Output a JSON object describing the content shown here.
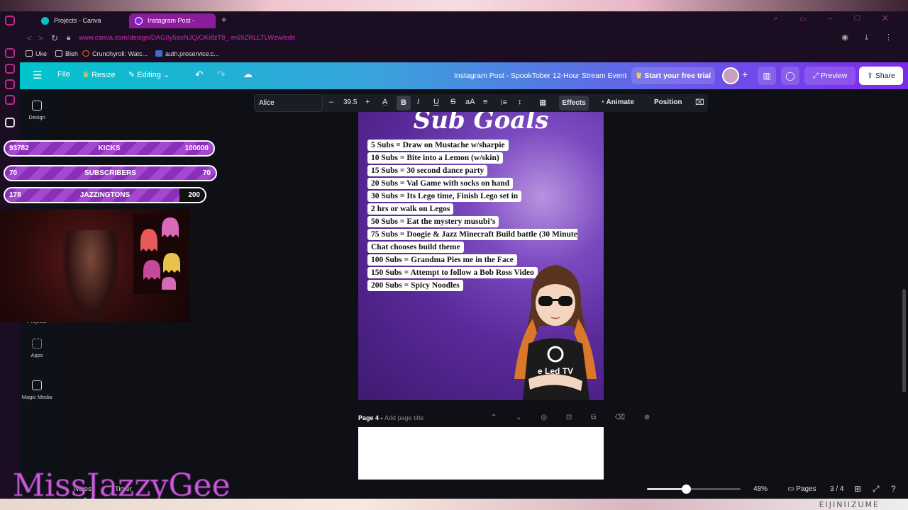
{
  "browser": {
    "tabs": [
      {
        "label": "Projects - Canva"
      },
      {
        "label": "Instagram Post - SpookTo"
      }
    ],
    "url": "www.canva.com/design/DAG0y5asNJQ/OKi8zT8_-m69ZRLLTLWzw/edit",
    "bookmarks": [
      {
        "label": "Uke"
      },
      {
        "label": "Bleh"
      },
      {
        "label": "Crunchyroll: Watc..."
      },
      {
        "label": "auth.proservice.c..."
      }
    ]
  },
  "header": {
    "file_label": "File",
    "resize_label": "Resize",
    "editing_label": "Editing",
    "title": "Instagram Post - SpookTober 12-Hour Stream Event",
    "trial_label": "Start your free trial",
    "preview_label": "Preview",
    "share_label": "Share"
  },
  "sidebar": {
    "items": [
      {
        "label": "Design"
      },
      {
        "label": "Projects"
      },
      {
        "label": "Apps"
      },
      {
        "label": "Magic Media"
      }
    ]
  },
  "toolbar": {
    "font": "Alice",
    "font_size": "39.5",
    "effects_label": "Effects",
    "animate_label": "Animate",
    "position_label": "Position"
  },
  "design": {
    "title": "Sub Goals",
    "goals": [
      "5 Subs = Draw on Mustache w/sharpie",
      "10 Subs = Bite into a Lemon (w/skin)",
      "15 Subs = 30 second dance party",
      "20 Subs = Val Game with socks on hand",
      "30 Subs = Its Lego time, Finish Lego set in",
      " 2 hrs or walk on Legos",
      "50 Subs = Eat the mystery musubi’s",
      "75 Subs = Doogie & Jazz Minecraft Build battle (30 Minute",
      "Chat chooses build theme",
      "100 Subs = Grandma Pies me in the Face",
      "150 Subs = Attempt to follow a Bob Ross Video",
      "200 Subs = Spicy Noodles"
    ],
    "shirt_text": "e Led TV"
  },
  "page4": {
    "label": "Page 4 -",
    "placeholder": "Add page title"
  },
  "overlays": {
    "goal_bars": [
      {
        "current": "93782",
        "label": "KICKS",
        "target": "100000"
      },
      {
        "current": "70",
        "label": "SUBSCRIBERS",
        "target": "70"
      },
      {
        "current": "178",
        "label": "JAZZINGTONS",
        "target": "200"
      }
    ],
    "streamer_name": "MissJazzyGee",
    "bottom_watermark": "EIJINIIZUME"
  },
  "footer": {
    "notes_label": "Notes",
    "timer_label": "Timer",
    "zoom": "48%",
    "zoom_level": 0.42,
    "pages_label": "Pages",
    "page_count": "3 / 4"
  },
  "colors": {
    "accent_purple": "#7d2ae8",
    "accent_teal": "#00c4cc",
    "tab_active": "#8d1c9c",
    "overlay_bar": "#a647d0"
  }
}
